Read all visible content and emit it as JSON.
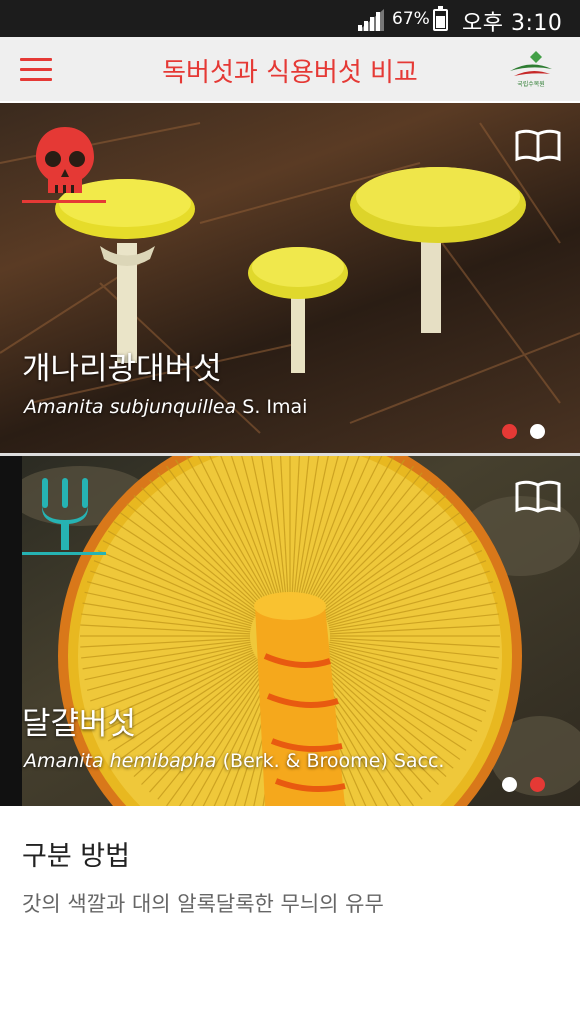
{
  "status_bar": {
    "battery_percent": "67%",
    "battery_level": 0.67,
    "time": "오후 3:10"
  },
  "app_bar": {
    "title": "독버섯과 식용버섯 비교",
    "menu_icon": "hamburger-menu-icon",
    "logo_label": "국립수목원",
    "accent_color": "#e53935"
  },
  "cards": [
    {
      "type": "poisonous",
      "type_icon": "skull-icon",
      "type_color": "#e53935",
      "name_ko": "개나리광대버섯",
      "name_genus_species": "Amanita subjunquillea",
      "name_author": " S. Imai",
      "book_icon": "book-icon",
      "page_indicator": {
        "total": 2,
        "active": 1,
        "active_color": "#e53935"
      }
    },
    {
      "type": "edible",
      "type_icon": "fork-icon",
      "type_color": "#26b3b3",
      "name_ko": "달걀버섯",
      "name_genus_species": "Amanita hemibapha",
      "name_author": " (Berk. & Broome) Sacc.",
      "book_icon": "book-icon",
      "page_indicator": {
        "total": 2,
        "active": 2,
        "active_color": "#e53935"
      }
    }
  ],
  "method": {
    "title": "구분 방법",
    "description": "갓의 색깔과 대의 알록달록한 무늬의 유무"
  }
}
